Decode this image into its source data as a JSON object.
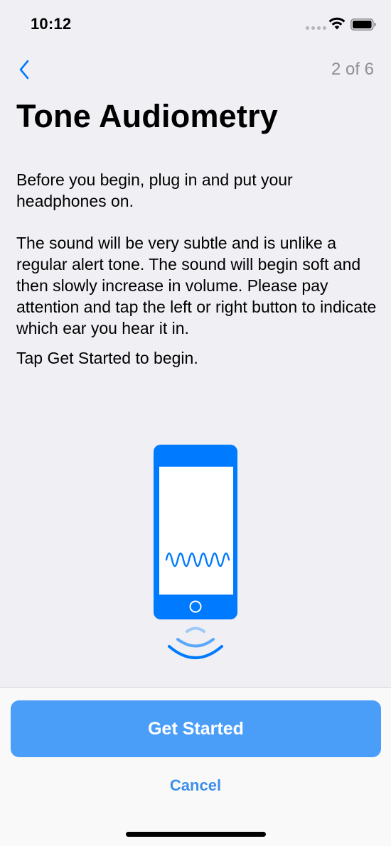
{
  "status_bar": {
    "time": "10:12",
    "icons": [
      "signal-dots-icon",
      "wifi-icon",
      "battery-icon"
    ]
  },
  "nav": {
    "back_icon": "chevron-left-icon",
    "step_indicator": "2 of 6"
  },
  "content": {
    "title": "Tone Audiometry",
    "paragraphs": [
      "Before you begin, plug in and put your headphones on.",
      "The sound will be very subtle and is unlike a regular alert tone.  The sound will begin soft and then slowly increase in volume.  Please pay attention and tap the left or right button to indicate which ear you hear it in.",
      "Tap Get Started to begin."
    ],
    "illustration": "phone-with-sound-wave-icon"
  },
  "footer": {
    "primary_label": "Get Started",
    "secondary_label": "Cancel"
  },
  "colors": {
    "accent": "#007aff",
    "button": "#4a9ef8",
    "background": "#efeff4",
    "secondary_text": "#8e8e93"
  }
}
